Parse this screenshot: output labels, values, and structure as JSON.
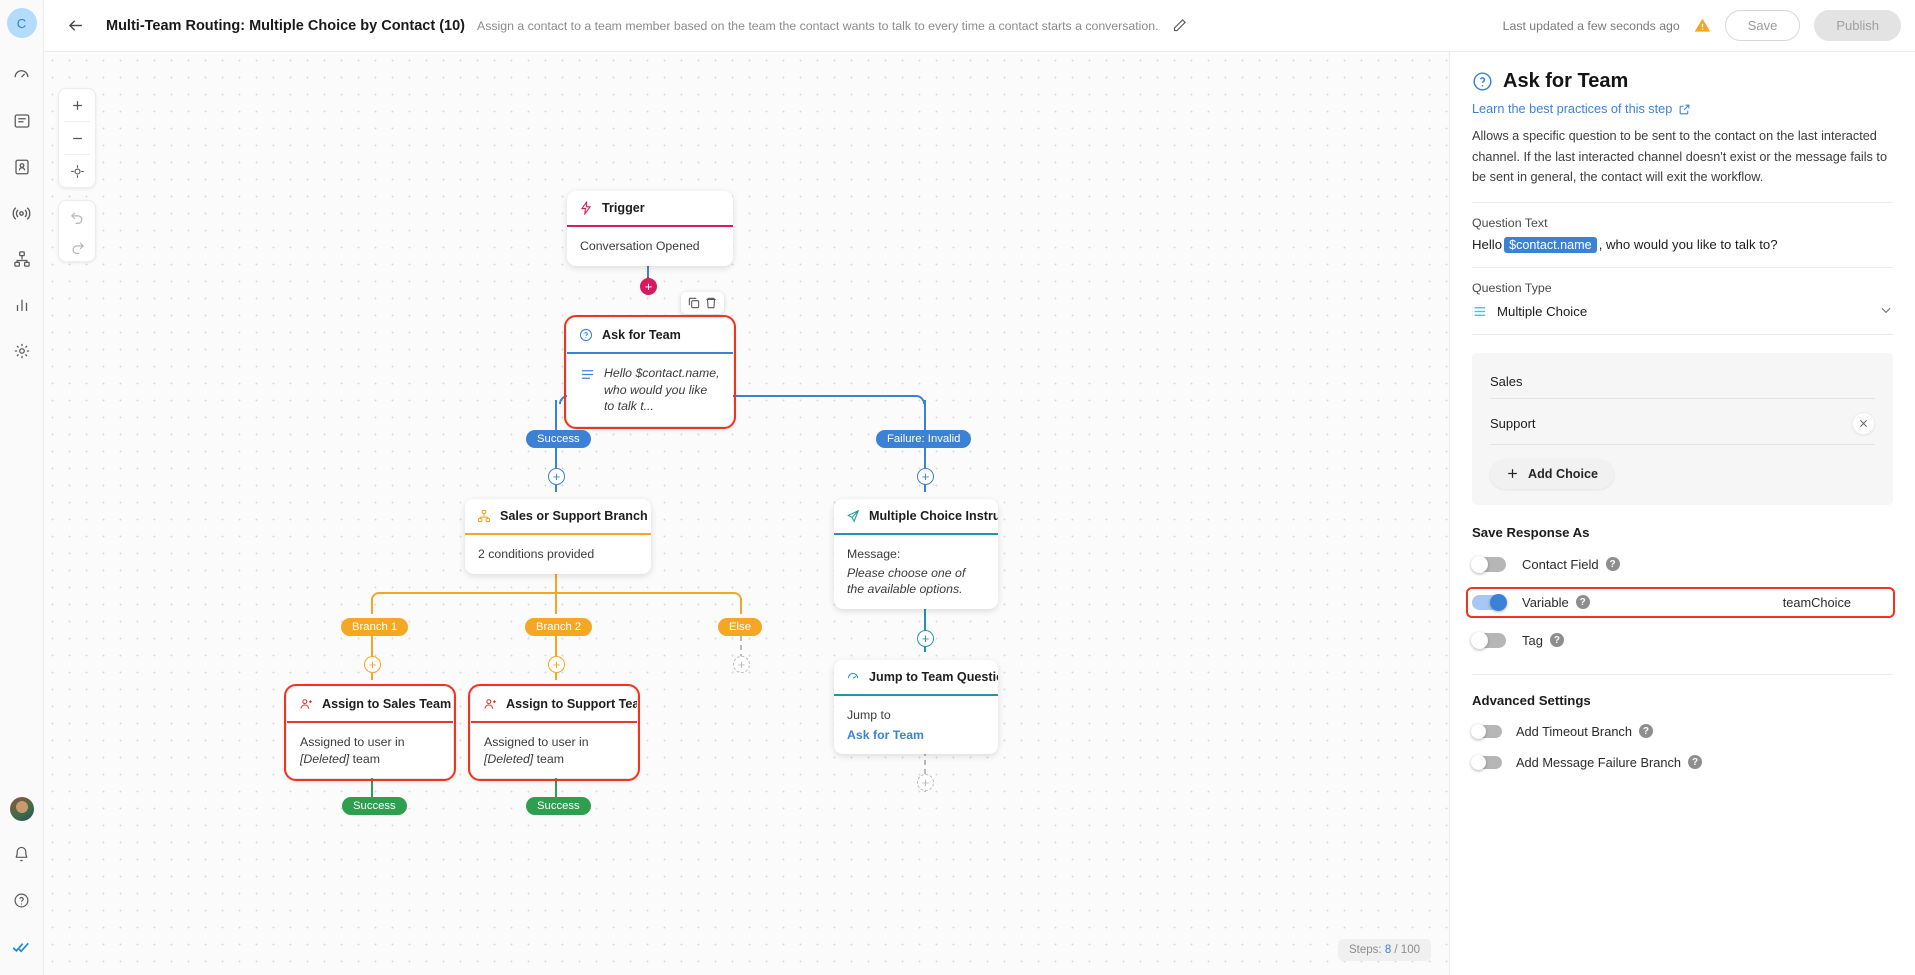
{
  "rail": {
    "avatar_initial": "C",
    "items": [
      {
        "name": "dashboard-icon"
      },
      {
        "name": "inbox-icon"
      },
      {
        "name": "contacts-icon"
      },
      {
        "name": "broadcast-icon"
      },
      {
        "name": "workflows-icon"
      },
      {
        "name": "reports-icon"
      },
      {
        "name": "settings-icon"
      }
    ],
    "bottom": [
      {
        "name": "user-avatar"
      },
      {
        "name": "notifications-icon"
      },
      {
        "name": "help-icon"
      },
      {
        "name": "status-check-icon"
      }
    ]
  },
  "header": {
    "back_icon": "arrow-left-icon",
    "title": "Multi-Team Routing: Multiple Choice by Contact (10)",
    "description": "Assign a contact to a team member based on the team the contact wants to talk to every time a contact starts a conversation.",
    "edit_icon": "pencil-icon",
    "updated_text": "Last updated a few seconds ago",
    "warning_icon": "warning-triangle-icon",
    "save_label": "Save",
    "publish_label": "Publish"
  },
  "canvas": {
    "zoom_in": "plus-icon",
    "zoom_out": "minus-icon",
    "fit_view": "target-icon",
    "undo": "undo-icon",
    "redo": "redo-icon",
    "steps_label": "Steps:",
    "steps_value": "8",
    "steps_total": "/ 100",
    "hover_copy_icon": "copy-icon",
    "hover_delete_icon": "trash-icon",
    "nodes": [
      {
        "id": "trigger",
        "title": "Trigger",
        "icon": "lightning-icon",
        "body": "Conversation Opened",
        "accent": "#d81b60",
        "selected": false
      },
      {
        "id": "ask-for-team",
        "title": "Ask for Team",
        "icon": "question-circle-icon",
        "body": "Hello $contact.name, who would you like to talk t...",
        "accent": "#3b82d6",
        "selected": true
      },
      {
        "id": "sales-or-support-branch",
        "title": "Sales or Support Branch",
        "icon": "branch-icon",
        "body": "2 conditions provided",
        "accent": "#f5a623",
        "selected": false
      },
      {
        "id": "multiple-choice-instructions",
        "title": "Multiple Choice Instructi...",
        "icon": "send-icon",
        "body_label": "Message:",
        "body": "Please choose one of the available options.",
        "accent": "#2196a6",
        "selected": false
      },
      {
        "id": "jump-to-team-question",
        "title": "Jump to Team Question",
        "icon": "jump-icon",
        "body_label": "Jump to",
        "body": "Ask for Team",
        "accent": "#2196a6",
        "selected": false
      },
      {
        "id": "assign-to-sales-team",
        "title": "Assign to Sales Team",
        "icon": "assign-user-icon",
        "body": "Assigned to user in [Deleted] team",
        "accent": "#e53935",
        "selected": true
      },
      {
        "id": "assign-to-support-team",
        "title": "Assign to Support Team",
        "icon": "assign-user-icon",
        "body": "Assigned to user in [Deleted] team",
        "accent": "#e53935",
        "selected": true
      }
    ],
    "chips": [
      {
        "label": "Success",
        "color": "#3b82d6"
      },
      {
        "label": "Failure: Invalid",
        "color": "#3b82d6"
      },
      {
        "label": "Branch 1",
        "color": "#f5a623"
      },
      {
        "label": "Branch 2",
        "color": "#f5a623"
      },
      {
        "label": "Else",
        "color": "#f5a623"
      },
      {
        "label": "Success",
        "color": "#2e9e4f"
      },
      {
        "label": "Success",
        "color": "#2e9e4f"
      }
    ]
  },
  "panel": {
    "icon": "question-circle-icon",
    "title": "Ask for Team",
    "link_text": "Learn the best practices of this step",
    "link_icon": "external-link-icon",
    "description": "Allows a specific question to be sent to the contact on the last interacted channel. If the last interacted channel doesn't exist or the message fails to be sent in general, the contact will exit the workflow.",
    "question_text_label": "Question Text",
    "question_text_prefix": "Hello ",
    "question_text_token": "$contact.name",
    "question_text_suffix": ", who would you like to talk to?",
    "question_type_label": "Question Type",
    "question_type_value": "Multiple Choice",
    "question_type_icon": "list-icon",
    "chevron_icon": "chevron-down-icon",
    "choices": [
      {
        "label": "Sales",
        "removable": false
      },
      {
        "label": "Support",
        "removable": true
      }
    ],
    "add_choice_label": "Add Choice",
    "add_choice_icon": "plus-icon",
    "save_response_label": "Save Response As",
    "toggles": [
      {
        "label": "Contact Field",
        "on": false,
        "value": "",
        "highlighted": false
      },
      {
        "label": "Variable",
        "on": true,
        "value": "teamChoice",
        "highlighted": true
      },
      {
        "label": "Tag",
        "on": false,
        "value": "",
        "highlighted": false
      }
    ],
    "advanced_label": "Advanced Settings",
    "advanced_toggles": [
      {
        "label": "Add Timeout Branch",
        "on": false
      },
      {
        "label": "Add Message Failure Branch",
        "on": false
      }
    ],
    "help_icon": "question-mark-icon"
  },
  "colors": {
    "accent_blue": "#3b82d6",
    "orange": "#f5a623",
    "green": "#2e9e4f",
    "teal": "#2196a6",
    "red_highlight": "#f2331d",
    "pink": "#d81b60"
  }
}
